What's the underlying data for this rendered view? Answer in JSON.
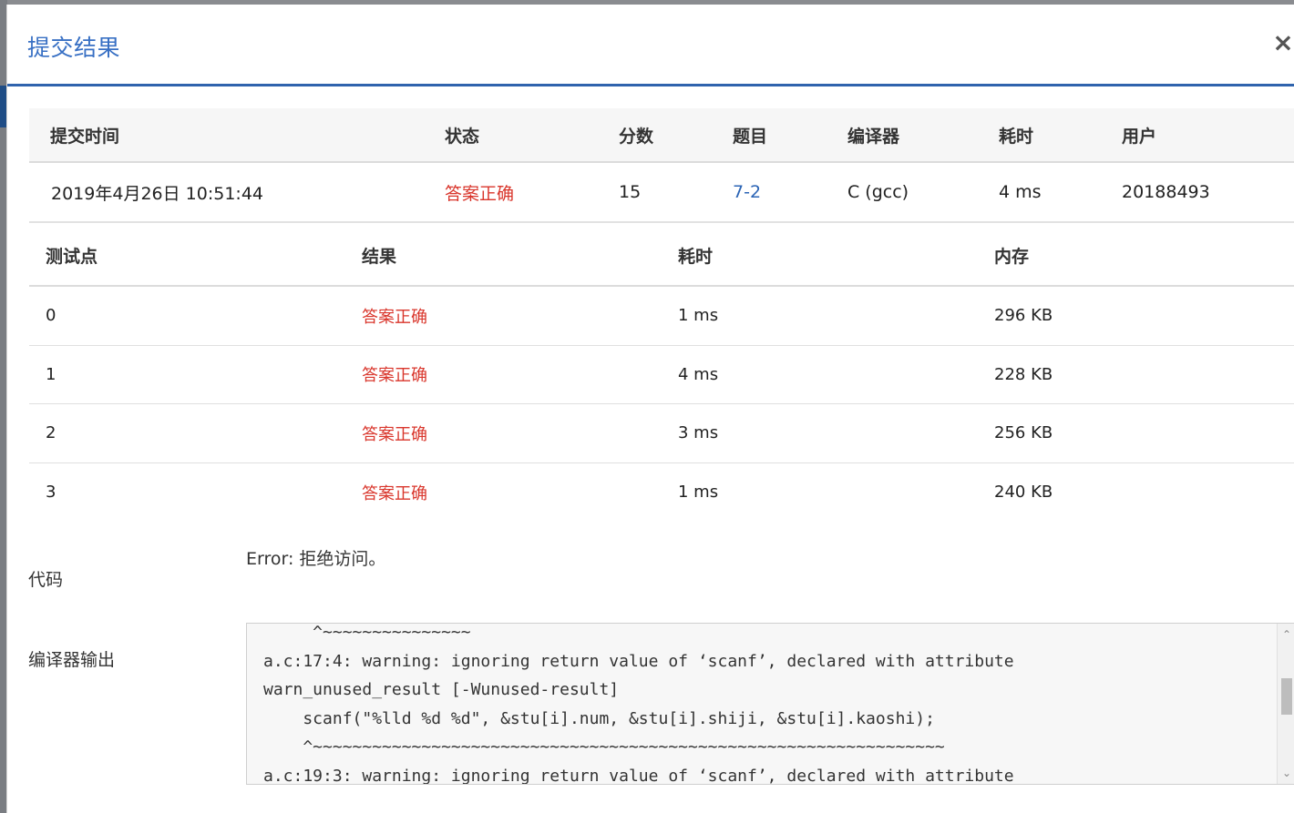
{
  "modal": {
    "title": "提交结果",
    "close_label": "×"
  },
  "submission": {
    "headers": [
      "提交时间",
      "状态",
      "分数",
      "题目",
      "编译器",
      "耗时",
      "用户"
    ],
    "row": {
      "time": "2019年4月26日 10:51:44",
      "status": "答案正确",
      "score": "15",
      "problem": "7-2",
      "compiler": "C (gcc)",
      "elapsed": "4 ms",
      "user": "20188493"
    }
  },
  "testcases": {
    "headers": [
      "测试点",
      "结果",
      "耗时",
      "内存"
    ],
    "rows": [
      {
        "id": "0",
        "result": "答案正确",
        "time": "1 ms",
        "memory": "296 KB"
      },
      {
        "id": "1",
        "result": "答案正确",
        "time": "4 ms",
        "memory": "228 KB"
      },
      {
        "id": "2",
        "result": "答案正确",
        "time": "3 ms",
        "memory": "256 KB"
      },
      {
        "id": "3",
        "result": "答案正确",
        "time": "1 ms",
        "memory": "240 KB"
      }
    ]
  },
  "code": {
    "label": "代码",
    "error": "Error: 拒绝访问。"
  },
  "compiler_output": {
    "label": "编译器输出",
    "text": "     ^~~~~~~~~~~~~~~~\na.c:17:4: warning: ignoring return value of ‘scanf’, declared with attribute\nwarn_unused_result [-Wunused-result]\n    scanf(\"%lld %d %d\", &stu[i].num, &stu[i].shiji, &stu[i].kaoshi);\n    ^~~~~~~~~~~~~~~~~~~~~~~~~~~~~~~~~~~~~~~~~~~~~~~~~~~~~~~~~~~~~~~~~\na.c:19:3: warning: ignoring return value of ‘scanf’, declared with attribute"
  },
  "colors": {
    "accent": "#3870c4",
    "status_ok": "#d9352b",
    "link": "#2b64b5"
  }
}
